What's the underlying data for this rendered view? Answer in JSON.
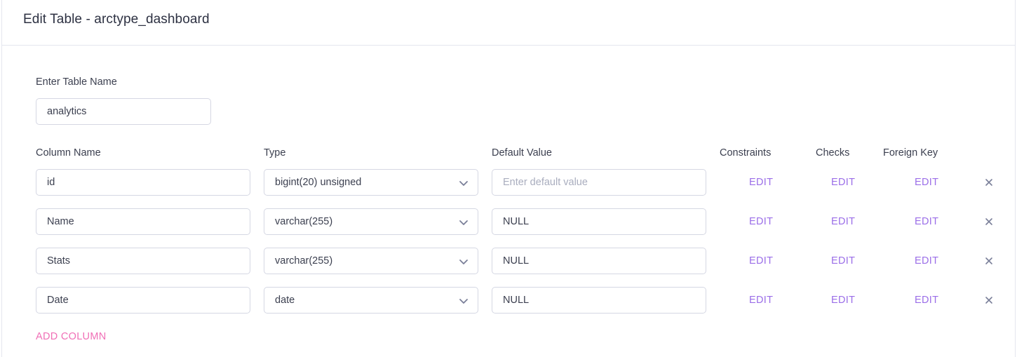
{
  "header": {
    "title": "Edit Table - arctype_dashboard"
  },
  "table_name": {
    "label": "Enter Table Name",
    "value": "analytics"
  },
  "columns_header": {
    "column_name": "Column Name",
    "type": "Type",
    "default_value": "Default Value",
    "constraints": "Constraints",
    "checks": "Checks",
    "foreign_key": "Foreign Key"
  },
  "rows": [
    {
      "name": "id",
      "type": "bigint(20) unsigned",
      "default": "",
      "default_placeholder": "Enter default value",
      "constraints": "EDIT",
      "checks": "EDIT",
      "foreign_key": "EDIT"
    },
    {
      "name": "Name",
      "type": "varchar(255)",
      "default": "NULL",
      "default_placeholder": "",
      "constraints": "EDIT",
      "checks": "EDIT",
      "foreign_key": "EDIT"
    },
    {
      "name": "Stats",
      "type": "varchar(255)",
      "default": "NULL",
      "default_placeholder": "",
      "constraints": "EDIT",
      "checks": "EDIT",
      "foreign_key": "EDIT"
    },
    {
      "name": "Date",
      "type": "date",
      "default": "NULL",
      "default_placeholder": "",
      "constraints": "EDIT",
      "checks": "EDIT",
      "foreign_key": "EDIT"
    }
  ],
  "add_column_label": "ADD COLUMN",
  "icons": {
    "select": "chevron-down-icon",
    "remove": "close-icon"
  },
  "colors": {
    "edit": "#9b6ee8",
    "add_column": "#f06fb6",
    "border": "#d5d7e3"
  }
}
